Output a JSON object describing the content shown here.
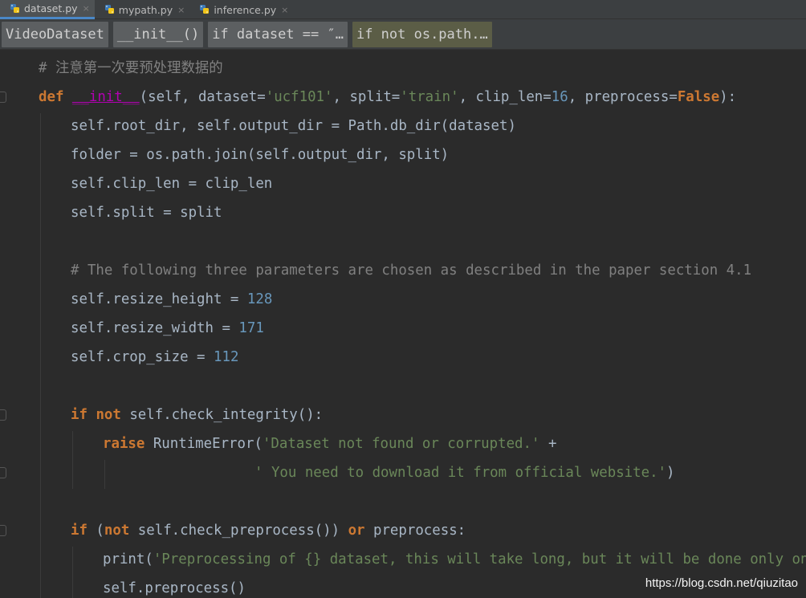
{
  "tabs": [
    {
      "label": "dataset.py",
      "close": "×",
      "active": true
    },
    {
      "label": "mypath.py",
      "close": "×",
      "active": false
    },
    {
      "label": "inference.py",
      "close": "×",
      "active": false
    }
  ],
  "breadcrumbs": [
    "VideoDataset",
    "__init__()",
    "if dataset == ″…",
    "if not os.path.…"
  ],
  "code": {
    "l1": {
      "c": "# 注意第一次要预处理数据的"
    },
    "l2": {
      "def": "def",
      "sp1": " ",
      "fn": "__init__",
      "a": "(self, dataset=",
      "s1": "'ucf101'",
      "b": ", split=",
      "s2": "'train'",
      "c": ", clip_len=",
      "n1": "16",
      "d": ", preprocess=",
      "k": "False",
      "e": "):"
    },
    "l3": {
      "t": "self.root_dir, self.output_dir = Path.db_dir(dataset)"
    },
    "l4": {
      "t": "folder = os.path.join(self.output_dir, split)"
    },
    "l5": {
      "t": "self.clip_len = clip_len"
    },
    "l6": {
      "t": "self.split = split"
    },
    "l7": {
      "c": "# The following three parameters are chosen as described in the paper section 4.1"
    },
    "l8": {
      "t": "self.resize_height = ",
      "n": "128"
    },
    "l9": {
      "t": "self.resize_width = ",
      "n": "171"
    },
    "l10": {
      "t": "self.crop_size = ",
      "n": "112"
    },
    "l11": {
      "k1": "if",
      "sp": " ",
      "k2": "not",
      "t": " self.check_integrity():"
    },
    "l12": {
      "k": "raise",
      "t": " RuntimeError(",
      "s": "'Dataset not found or corrupted.'",
      "e": " +"
    },
    "l13": {
      "s": "' You need to download it from official website.'",
      "e": ")"
    },
    "l14": {
      "k1": "if",
      "a": " (",
      "k2": "not",
      "b": " self.check_preprocess()) ",
      "k3": "or",
      "c": " preprocess:"
    },
    "l15": {
      "t": "print(",
      "s": "'Preprocessing of {} dataset, this will take long, but it will be done only once.'"
    },
    "l16": {
      "t": "self.preprocess()"
    }
  },
  "watermark": "https://blog.csdn.net/qiuzitao",
  "colors": {
    "keyword": "#cc7832",
    "string": "#6a8759",
    "number": "#6897bb",
    "comment": "#808080",
    "text": "#a9b7c6",
    "background": "#2b2b2b"
  }
}
